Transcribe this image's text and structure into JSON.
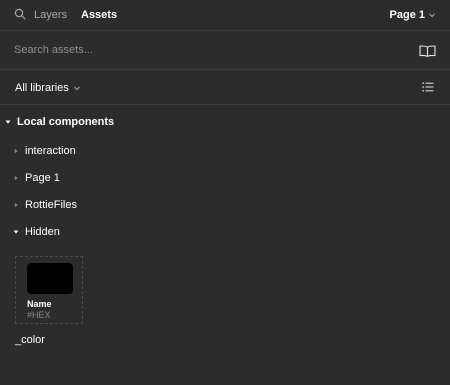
{
  "topbar": {
    "tabs": [
      {
        "label": "Layers"
      },
      {
        "label": "Assets"
      }
    ],
    "active_tab": "Assets",
    "page_selector": "Page 1",
    "icons": [
      "search-icon",
      "chevron-down-icon"
    ]
  },
  "search": {
    "placeholder": "Search assets...",
    "value": "",
    "library_button_icon": "book-icon"
  },
  "library_filter": {
    "selected": "All libraries",
    "view_toggle_icon": "list-view-icon"
  },
  "local_components": {
    "title": "Local components",
    "expanded": true,
    "groups": [
      {
        "label": "interaction",
        "expanded": false
      },
      {
        "label": "Page 1",
        "expanded": false
      },
      {
        "label": "RottieFiles",
        "expanded": false
      },
      {
        "label": "Hidden",
        "expanded": true
      }
    ]
  },
  "hidden_components": [
    {
      "name": "_color",
      "preview": {
        "swatch_color": "#000000",
        "title": "Name",
        "subtitle": "#HEX"
      }
    }
  ],
  "colors": {
    "panel_bg": "#2c2c2c",
    "text": "#ffffff",
    "muted_text": "#a8a8a8",
    "divider": "#3a3a3a"
  }
}
